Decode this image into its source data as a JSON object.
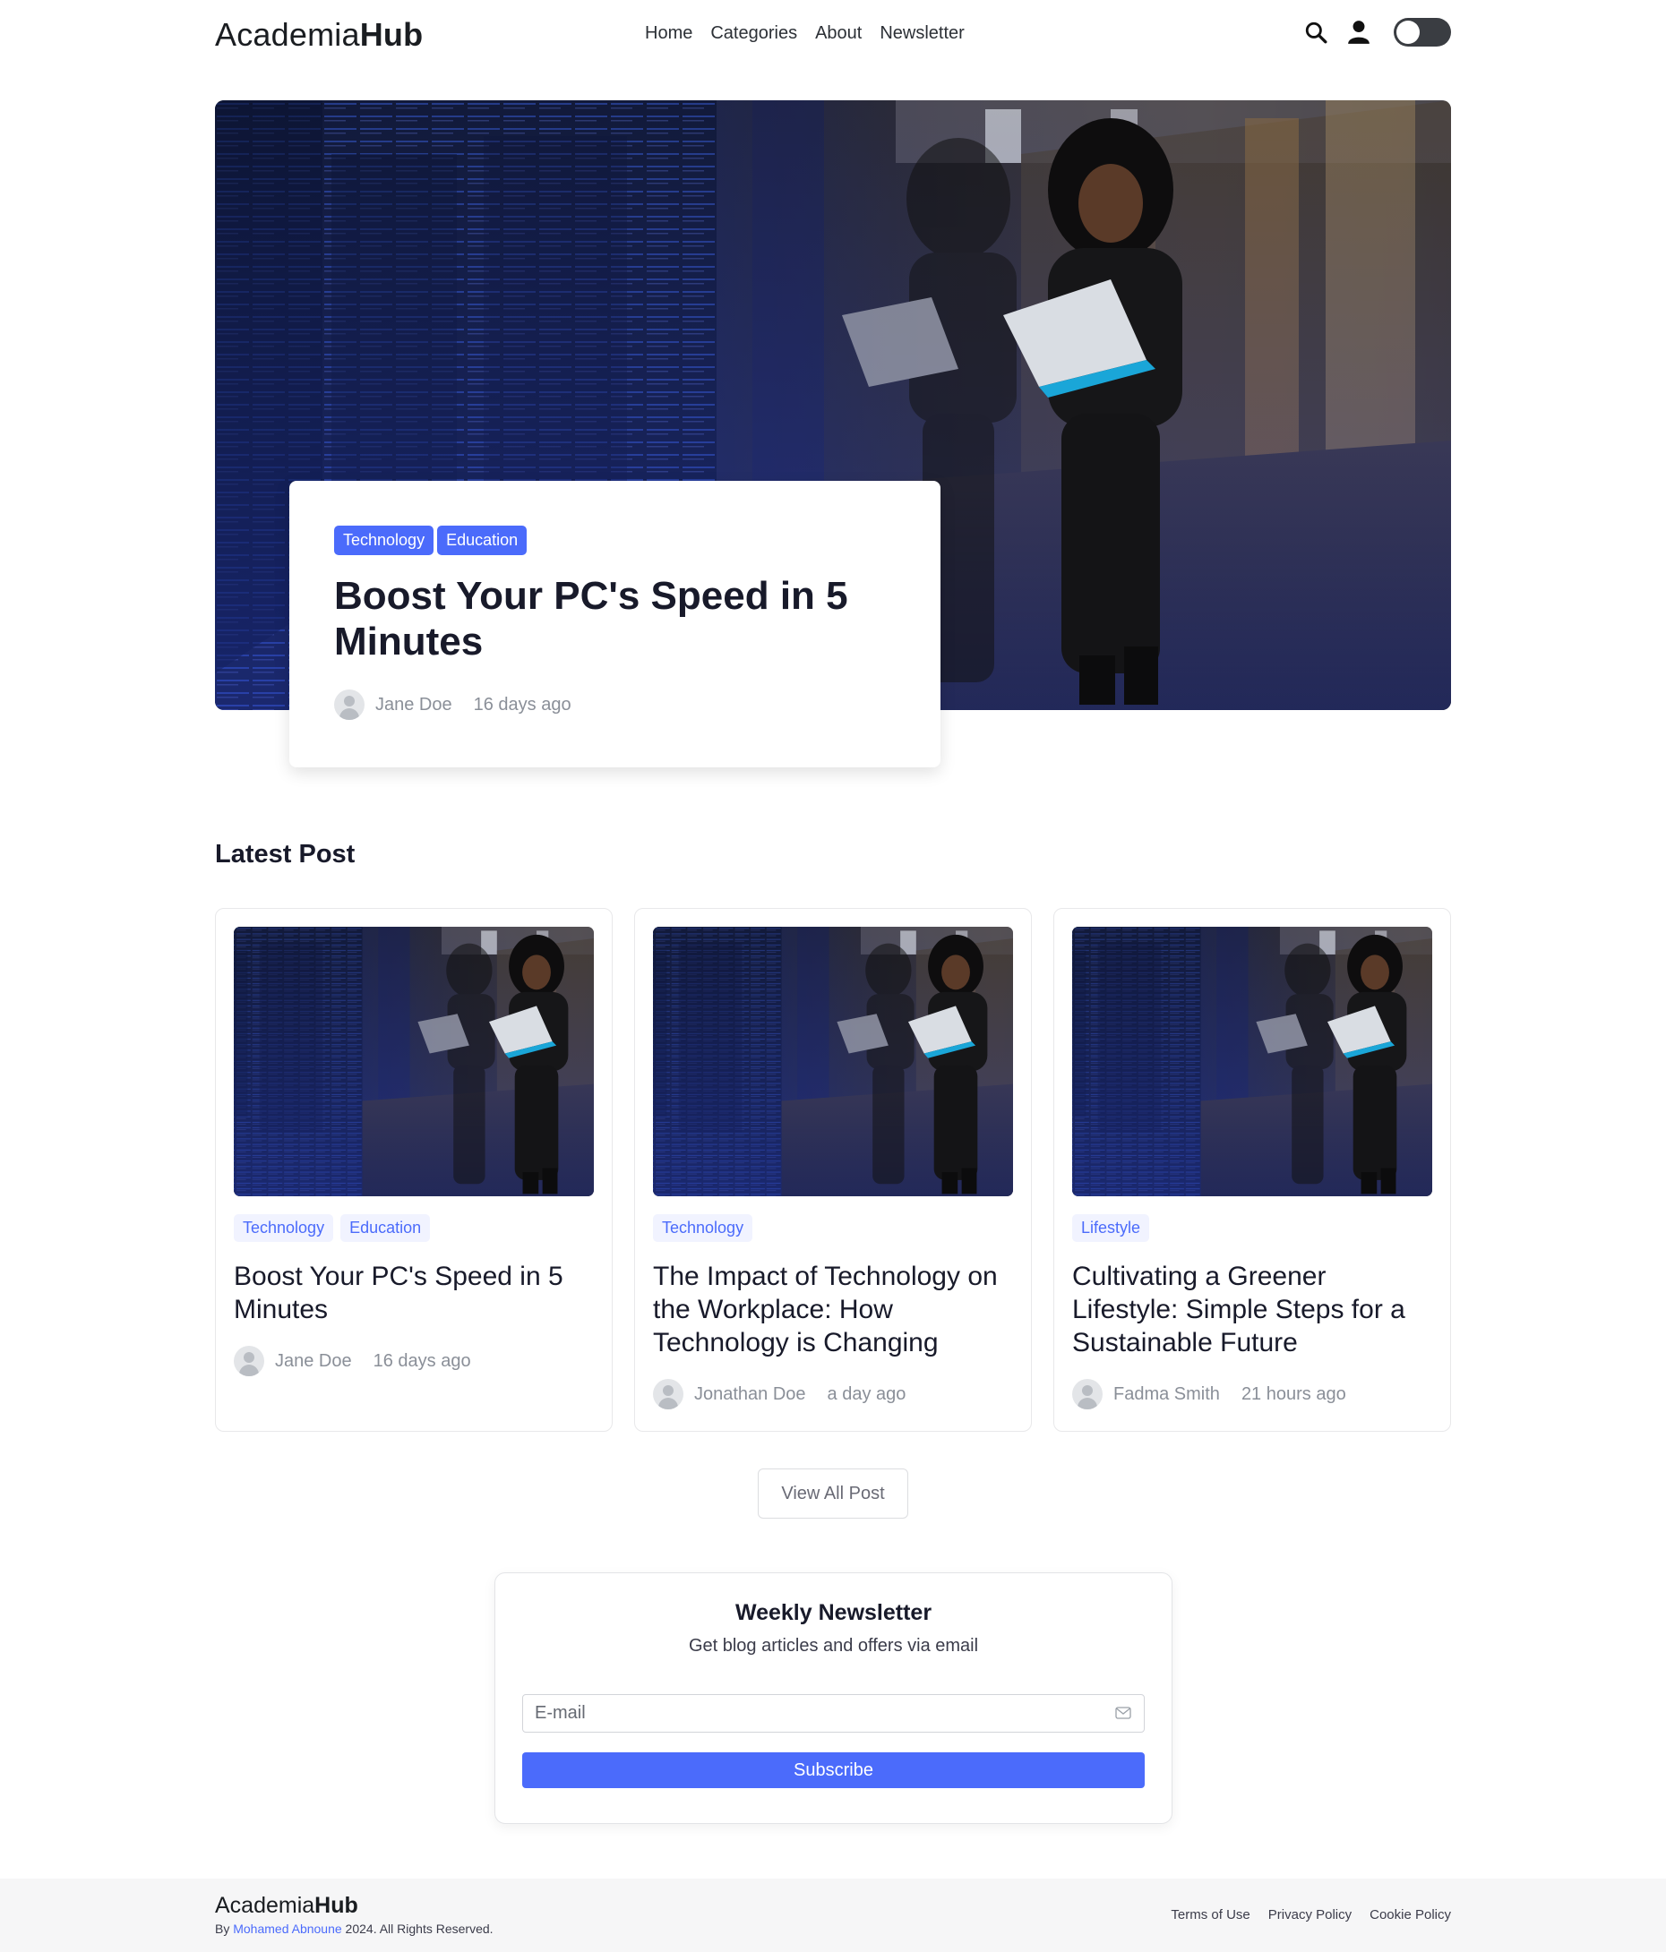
{
  "header": {
    "logo_light": "Academia",
    "logo_bold": "Hub",
    "nav": [
      "Home",
      "Categories",
      "About",
      "Newsletter"
    ],
    "icons": [
      "search-icon",
      "user-icon",
      "theme-toggle"
    ]
  },
  "hero": {
    "tags": [
      "Technology",
      "Education"
    ],
    "title": "Boost Your PC's Speed in 5 Minutes",
    "author": "Jane Doe",
    "date": "16 days ago"
  },
  "latest": {
    "title": "Latest Post",
    "posts": [
      {
        "tags": [
          "Technology",
          "Education"
        ],
        "title": "Boost Your PC's Speed in 5 Minutes",
        "author": "Jane Doe",
        "date": "16 days ago"
      },
      {
        "tags": [
          "Technology"
        ],
        "title": "The Impact of Technology on the Workplace: How Technology is Changing",
        "author": "Jonathan Doe",
        "date": "a day ago"
      },
      {
        "tags": [
          "Lifestyle"
        ],
        "title": "Cultivating a Greener Lifestyle: Simple Steps for a Sustainable Future",
        "author": "Fadma Smith",
        "date": "21 hours ago"
      }
    ],
    "view_all": "View All Post"
  },
  "newsletter": {
    "title": "Weekly Newsletter",
    "subtitle": "Get blog articles and offers via email",
    "email_placeholder": "E-mail",
    "button": "Subscribe"
  },
  "footer": {
    "logo_light": "Academia",
    "logo_bold": "Hub",
    "by": "By ",
    "author": "Mohamed Abnoune",
    "rights": " 2024. All Rights Reserved.",
    "links": [
      "Terms of Use",
      "Privacy Policy",
      "Cookie Policy"
    ]
  },
  "colors": {
    "accent": "#4b6bfb",
    "text": "#181a2a",
    "muted": "#8a8f98",
    "footer_bg": "#f6f6f7"
  }
}
